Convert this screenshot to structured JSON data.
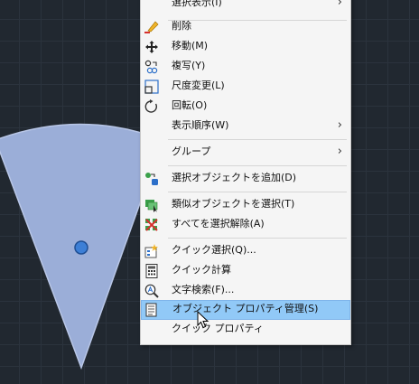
{
  "colors": {
    "canvas_bg": "#212830",
    "grid_line": "#2b333d",
    "sector_fill": "#9baed8",
    "sector_stroke": "#b8c6e6",
    "grip_fill": "#3d7fd6",
    "menu_bg": "#f5f5f5",
    "highlight": "#91c9f7"
  },
  "canvas": {
    "selected_object": "sector-shape",
    "grip": "blue-grip"
  },
  "context_menu": {
    "items": [
      {
        "label": "選択表示(I)",
        "icon": "none",
        "submenu": true
      },
      {
        "label": "削除",
        "icon": "eraser-icon",
        "submenu": false
      },
      {
        "label": "移動(M)",
        "icon": "move-icon",
        "submenu": false
      },
      {
        "label": "複写(Y)",
        "icon": "copy-icon",
        "submenu": false
      },
      {
        "label": "尺度変更(L)",
        "icon": "scale-icon",
        "submenu": false
      },
      {
        "label": "回転(O)",
        "icon": "rotate-icon",
        "submenu": false
      },
      {
        "label": "表示順序(W)",
        "icon": "none",
        "submenu": true
      },
      {
        "label": "グループ",
        "icon": "none",
        "submenu": true
      },
      {
        "label": "選択オブジェクトを追加(D)",
        "icon": "add-selected-icon",
        "submenu": false
      },
      {
        "label": "類似オブジェクトを選択(T)",
        "icon": "select-similar-icon",
        "submenu": false
      },
      {
        "label": "すべてを選択解除(A)",
        "icon": "deselect-all-icon",
        "submenu": false
      },
      {
        "label": "クイック選択(Q)...",
        "icon": "quick-select-icon",
        "submenu": false
      },
      {
        "label": "クイック計算",
        "icon": "calculator-icon",
        "submenu": false
      },
      {
        "label": "文字検索(F)...",
        "icon": "find-text-icon",
        "submenu": false
      },
      {
        "label": "オブジェクト プロパティ管理(S)",
        "icon": "properties-icon",
        "submenu": false,
        "highlighted": true
      },
      {
        "label": "クイック プロパティ",
        "icon": "none",
        "submenu": false
      }
    ]
  }
}
